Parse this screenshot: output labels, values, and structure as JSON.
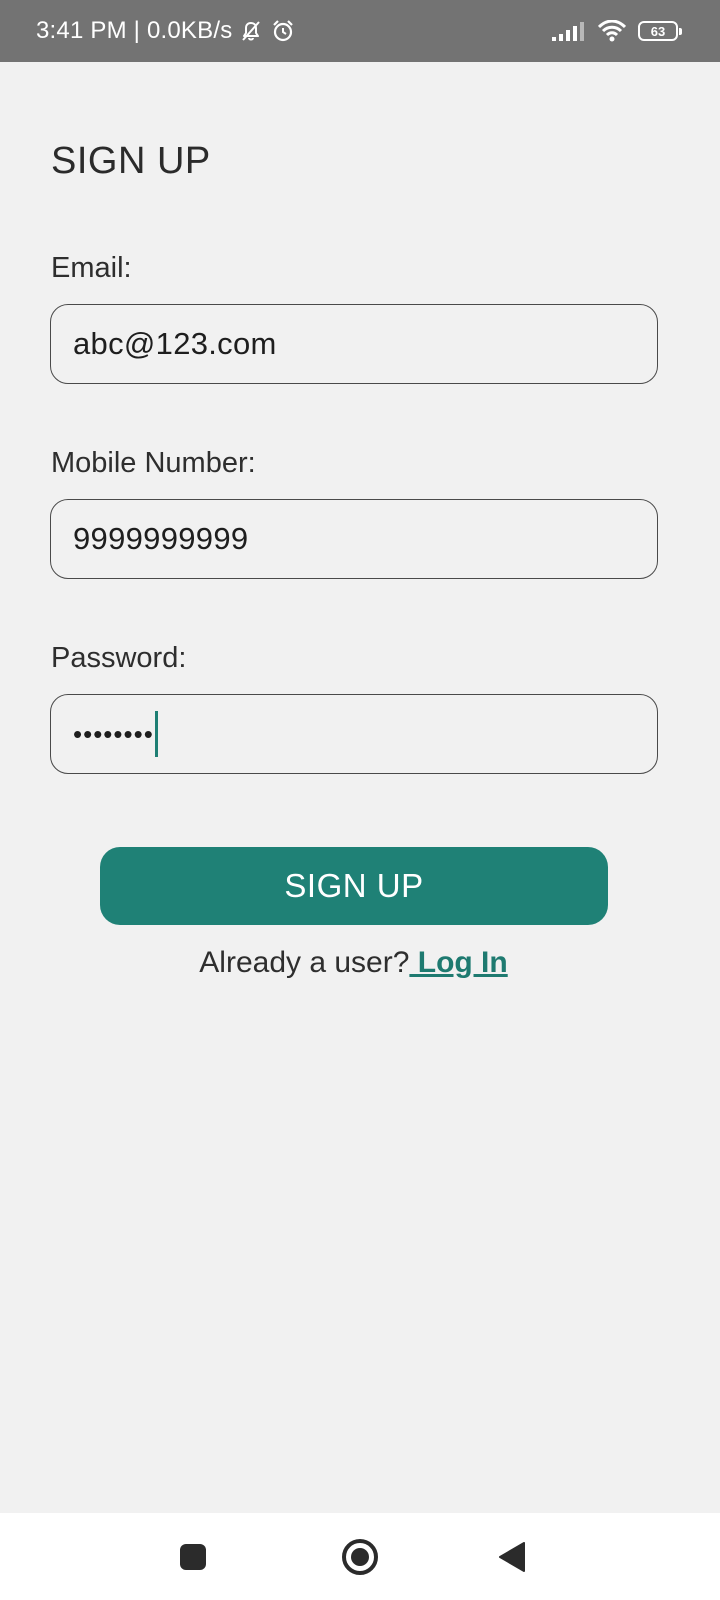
{
  "status_bar": {
    "time_speed": "3:41 PM | 0.0KB/s",
    "battery_level": "63",
    "icons": [
      "bell-off-icon",
      "alarm-icon",
      "signal-icon",
      "wifi-icon",
      "battery-icon"
    ]
  },
  "page": {
    "title": "SIGN UP"
  },
  "form": {
    "email": {
      "label": "Email:",
      "value": "abc@123.com"
    },
    "mobile": {
      "label": "Mobile Number:",
      "value": "9999999999"
    },
    "password": {
      "label": "Password:",
      "masked_value": "••••••••"
    },
    "submit_label": "SIGN UP"
  },
  "login_prompt": {
    "text": "Already a user?",
    "link": " Log In"
  },
  "nav_bar": {
    "icons": [
      "recents-icon",
      "home-icon",
      "back-icon"
    ]
  },
  "colors": {
    "accent": "#1f8176",
    "status_bar": "#737373",
    "background": "#f1f1f1"
  }
}
